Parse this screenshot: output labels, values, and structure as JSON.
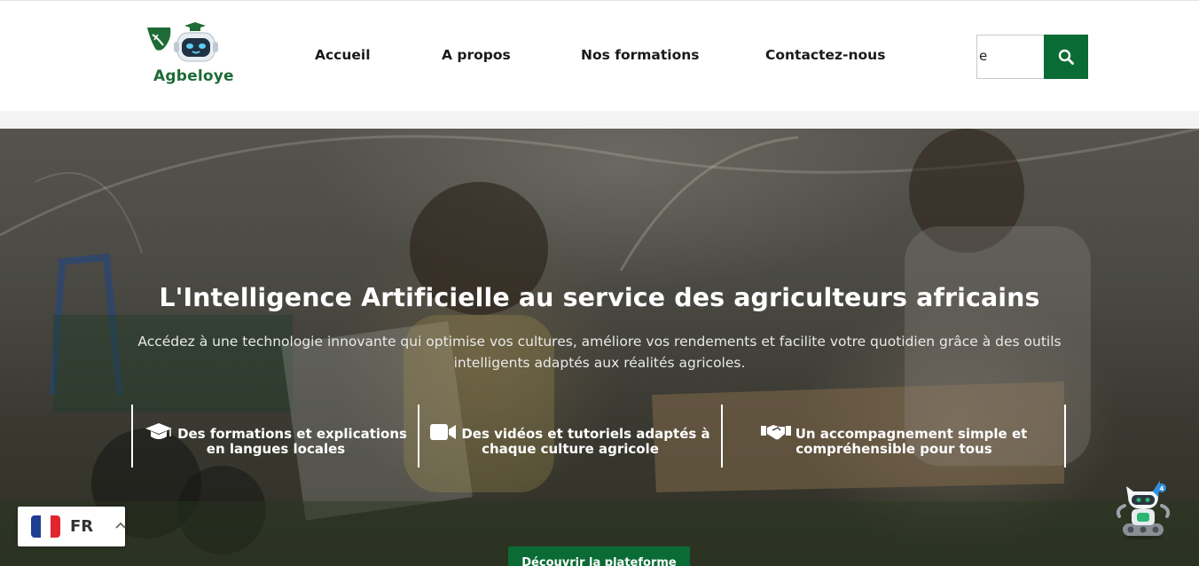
{
  "brand": {
    "name": "Agbeloye",
    "color": "#1e6b35"
  },
  "nav": {
    "items": [
      {
        "label": "Accueil"
      },
      {
        "label": "A propos"
      },
      {
        "label": "Nos formations"
      },
      {
        "label": "Contactez-nous"
      }
    ]
  },
  "search": {
    "value": "e",
    "icon": "search-icon",
    "button_color": "#0b6b35"
  },
  "hero": {
    "title": "L'Intelligence Artificielle au service des agriculteurs africains",
    "subtitle": "Accédez à une technologie innovante qui optimise vos cultures, améliore vos rendements et facilite votre quotidien grâce à des outils intelligents adaptés aux réalités agricoles.",
    "features": [
      {
        "icon": "graduation-cap-icon",
        "line1": "Des formations et explications",
        "line2": "en langues locales"
      },
      {
        "icon": "video-camera-icon",
        "line1": "Des vidéos et tutoriels adaptés à",
        "line2": "chaque culture agricole"
      },
      {
        "icon": "handshake-icon",
        "line1": "Un accompagnement simple et",
        "line2": "compréhensible pour tous"
      }
    ],
    "cta_label": "Découvrir la plateforme"
  },
  "language": {
    "code": "FR",
    "flag_icon": "france-flag-icon"
  },
  "chatbot": {
    "icon": "robot-chatbot-icon"
  }
}
